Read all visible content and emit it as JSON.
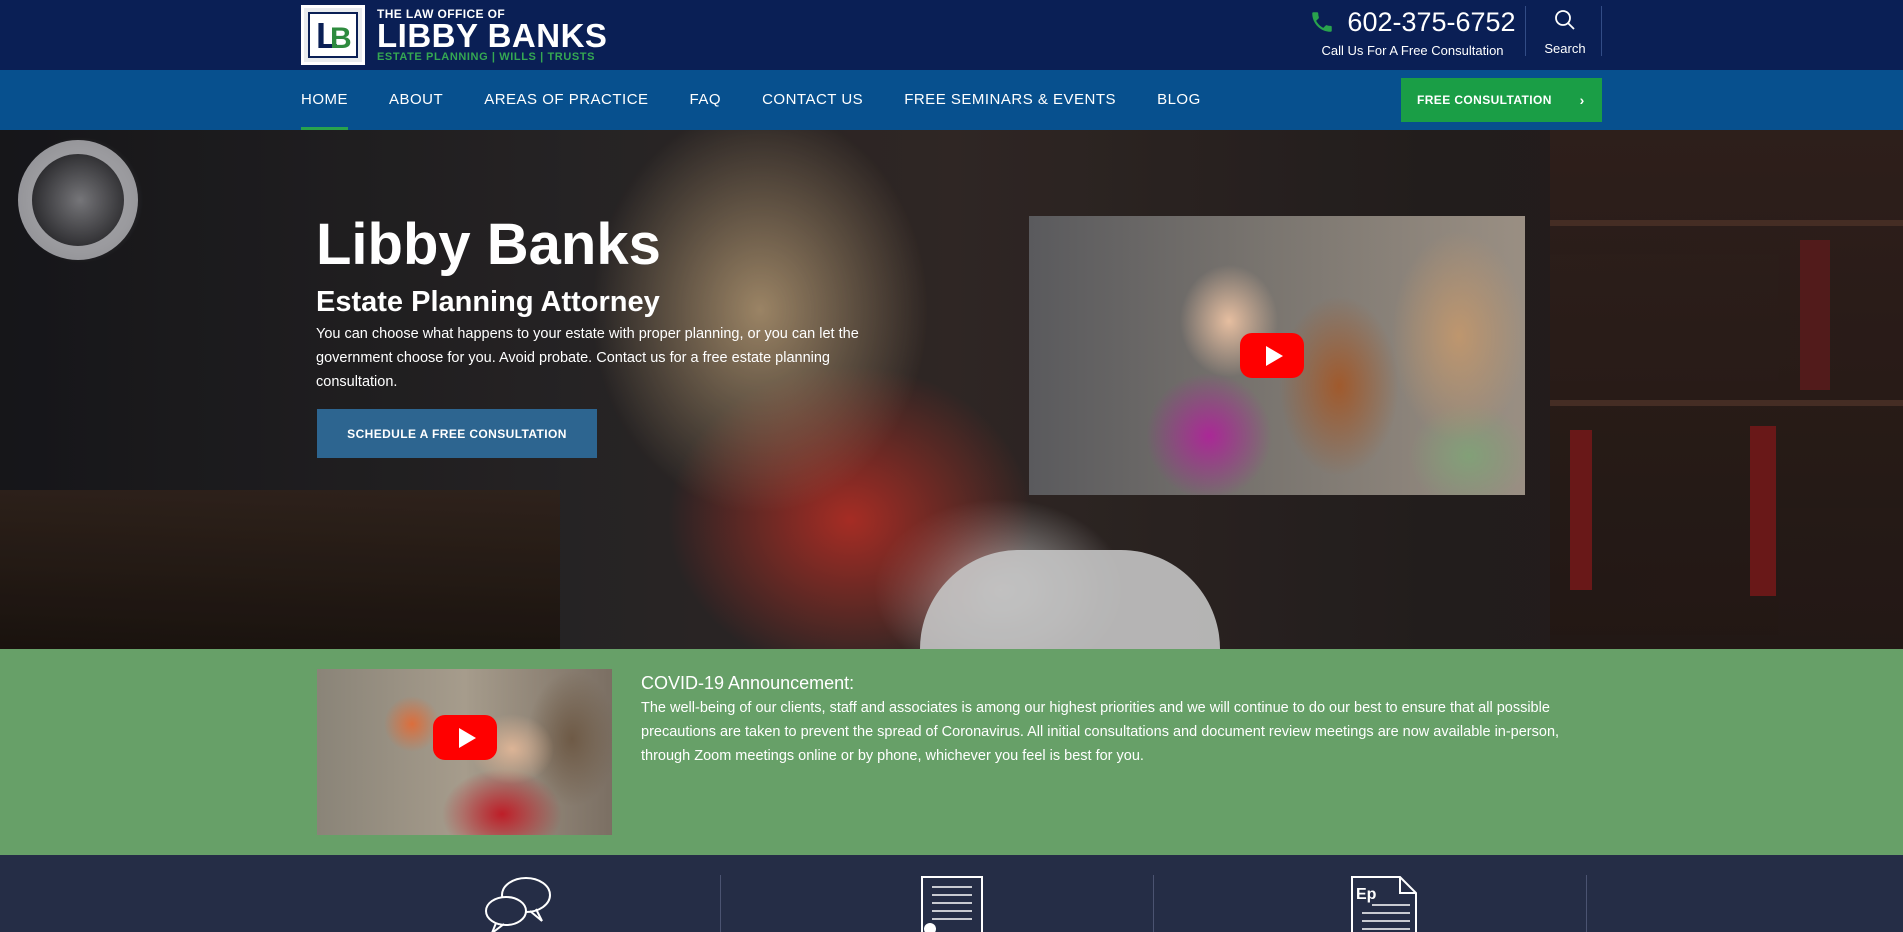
{
  "header": {
    "logo": {
      "small_text": "THE LAW OFFICE OF",
      "name": "LIBBY BANKS",
      "tagline": "ESTATE PLANNING | WILLS | TRUSTS"
    },
    "phone": "602-375-6752",
    "phone_subtitle": "Call Us For A Free Consultation",
    "search_label": "Search"
  },
  "nav": {
    "items": [
      {
        "label": "HOME",
        "active": true
      },
      {
        "label": "ABOUT"
      },
      {
        "label": "AREAS OF PRACTICE"
      },
      {
        "label": "FAQ"
      },
      {
        "label": "CONTACT US"
      },
      {
        "label": "FREE SEMINARS & EVENTS"
      },
      {
        "label": "BLOG"
      }
    ],
    "cta_label": "FREE CONSULTATION"
  },
  "hero": {
    "title": "Libby Banks",
    "subtitle": "Estate Planning Attorney",
    "text": "You can choose what happens to your estate with proper planning, or you can let the government choose for you. Avoid probate. Contact us for a free estate planning consultation.",
    "button_label": "SCHEDULE A FREE CONSULTATION"
  },
  "covid": {
    "title": "COVID-19 Announcement:",
    "text": "The well-being of our clients, staff and associates is among our highest priorities and we will continue to do our best to ensure that all possible precautions are taken to prevent the spread of Coronavirus. All initial consultations and document review meetings are now available in-person, through Zoom meetings online or by phone, whichever you feel is best for you."
  },
  "services": {
    "icons": [
      "speech-bubbles-icon",
      "document-pen-icon",
      "estate-plan-document-icon"
    ],
    "ep_label": "Ep"
  },
  "colors": {
    "topbar": "#0a1f55",
    "navbar": "#07508e",
    "accent_green": "#1a9e46",
    "covid_bg": "#67a068",
    "services_bg": "#252d46",
    "hero_button": "#2d6590"
  }
}
